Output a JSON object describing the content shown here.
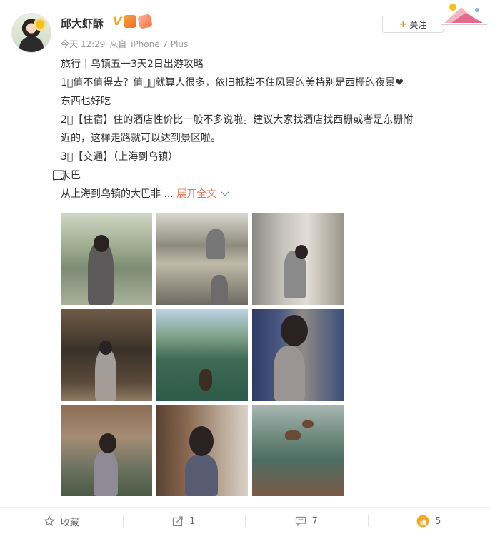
{
  "post": {
    "username": "邱大虾酥",
    "verified_mark": "V",
    "timestamp": "今天 12:29",
    "source_prefix": "来自",
    "source_device": "iPhone 7 Plus",
    "follow_button": "关注",
    "follow_plus": "+",
    "lines": [
      "旅行｜乌镇五一3天2日出游攻略",
      "1⃣值不值得去？值得⃣就算人很多，依旧抵挡不住风景的美特别是西栅的夜景❤",
      "东西也好吃",
      "2⃣【住宿】住的酒店性价比一般不多说啦。建议大家找酒店找西栅或者是东栅附",
      "近的，这样走路就可以达到景区啦。",
      "3⃣【交通】（上海到乌镇）",
      "⃣大巴"
    ],
    "truncated_line": "从上海到乌镇的大巴非 ...",
    "expand_label": "展开全文",
    "photos": [
      "photo-1",
      "photo-2",
      "photo-3",
      "photo-4",
      "photo-5",
      "photo-6",
      "photo-7",
      "photo-8",
      "photo-9"
    ]
  },
  "actions": {
    "favorite_label": "收藏",
    "forward_count": "1",
    "comment_count": "7",
    "like_count": "5"
  },
  "icons": {
    "favorite": "star-outline-icon",
    "forward": "share-arrow-icon",
    "comment": "comment-icon",
    "like": "thumbs-up-icon"
  },
  "colors": {
    "accent_orange": "#ff8200",
    "expand_link": "#eb7350",
    "like_icon": "#f6a623"
  }
}
